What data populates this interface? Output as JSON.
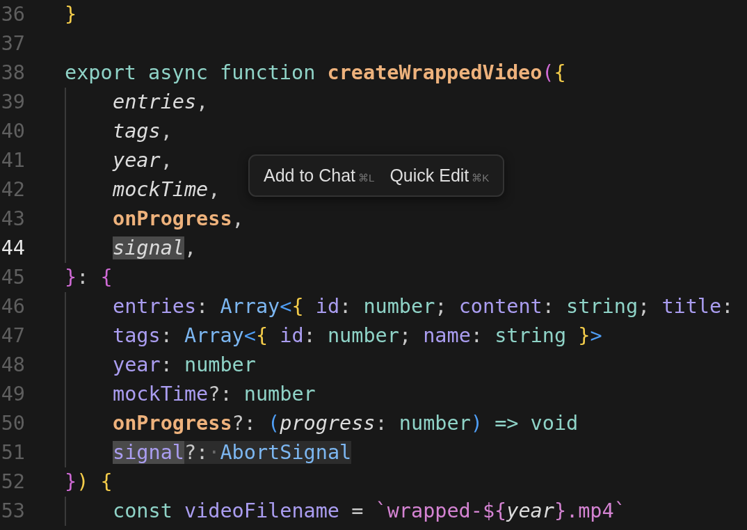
{
  "editor": {
    "lines": [
      {
        "number": "36",
        "active": false,
        "indented": false,
        "tokens": [
          {
            "kind": "brace-yellow",
            "text": "}"
          }
        ]
      },
      {
        "number": "37",
        "active": false,
        "indented": false
      },
      {
        "number": "38",
        "active": false,
        "indented": false,
        "tokens": [
          {
            "kind": "keyword",
            "text": "export async function "
          },
          {
            "kind": "func",
            "text": "createWrappedVideo"
          },
          {
            "kind": "brace-purple",
            "text": "("
          },
          {
            "kind": "brace-yellow",
            "text": "{"
          }
        ]
      },
      {
        "number": "39",
        "active": false,
        "indented": true,
        "tokens": [
          {
            "kind": "param",
            "text": "entries"
          },
          {
            "kind": "punct",
            "text": ","
          }
        ]
      },
      {
        "number": "40",
        "active": false,
        "indented": true,
        "tokens": [
          {
            "kind": "param",
            "text": "tags"
          },
          {
            "kind": "punct",
            "text": ","
          }
        ]
      },
      {
        "number": "41",
        "active": false,
        "indented": true,
        "tokens": [
          {
            "kind": "param",
            "text": "year"
          },
          {
            "kind": "punct",
            "text": ","
          }
        ]
      },
      {
        "number": "42",
        "active": false,
        "indented": true,
        "tokens": [
          {
            "kind": "param",
            "text": "mockTime"
          },
          {
            "kind": "punct",
            "text": ","
          }
        ]
      },
      {
        "number": "43",
        "active": false,
        "indented": true,
        "tokens": [
          {
            "kind": "param-bold",
            "text": "onProgress"
          },
          {
            "kind": "punct",
            "text": ","
          }
        ]
      },
      {
        "number": "44",
        "active": true,
        "indented": true,
        "tokens": [
          {
            "kind": "param",
            "text": "signal",
            "selected": true,
            "matched": false
          },
          {
            "kind": "punct",
            "text": ",",
            "selected": false,
            "matched": false
          }
        ]
      },
      {
        "number": "45",
        "active": false,
        "indented": false,
        "tokens": [
          {
            "kind": "brace-purple",
            "text": "}"
          },
          {
            "kind": "punct",
            "text": ": "
          },
          {
            "kind": "brace-purple",
            "text": "{"
          }
        ]
      },
      {
        "number": "46",
        "active": false,
        "indented": true,
        "tokens": [
          {
            "kind": "prop",
            "text": "entries"
          },
          {
            "kind": "punct",
            "text": ": "
          },
          {
            "kind": "class",
            "text": "Array"
          },
          {
            "kind": "brace-blue",
            "text": "<"
          },
          {
            "kind": "brace-yellow",
            "text": "{ "
          },
          {
            "kind": "prop",
            "text": "id"
          },
          {
            "kind": "punct",
            "text": ": "
          },
          {
            "kind": "type",
            "text": "number"
          },
          {
            "kind": "punct",
            "text": "; "
          },
          {
            "kind": "prop",
            "text": "content"
          },
          {
            "kind": "punct",
            "text": ": "
          },
          {
            "kind": "type",
            "text": "string"
          },
          {
            "kind": "punct",
            "text": "; "
          },
          {
            "kind": "prop",
            "text": "title"
          },
          {
            "kind": "punct",
            "text": ":"
          }
        ]
      },
      {
        "number": "47",
        "active": false,
        "indented": true,
        "tokens": [
          {
            "kind": "prop",
            "text": "tags"
          },
          {
            "kind": "punct",
            "text": ": "
          },
          {
            "kind": "class",
            "text": "Array"
          },
          {
            "kind": "brace-blue",
            "text": "<"
          },
          {
            "kind": "brace-yellow",
            "text": "{ "
          },
          {
            "kind": "prop",
            "text": "id"
          },
          {
            "kind": "punct",
            "text": ": "
          },
          {
            "kind": "type",
            "text": "number"
          },
          {
            "kind": "punct",
            "text": "; "
          },
          {
            "kind": "prop",
            "text": "name"
          },
          {
            "kind": "punct",
            "text": ": "
          },
          {
            "kind": "type",
            "text": "string "
          },
          {
            "kind": "brace-yellow",
            "text": "}"
          },
          {
            "kind": "brace-blue",
            "text": ">"
          }
        ]
      },
      {
        "number": "48",
        "active": false,
        "indented": true,
        "tokens": [
          {
            "kind": "prop",
            "text": "year"
          },
          {
            "kind": "punct",
            "text": ": "
          },
          {
            "kind": "type",
            "text": "number"
          }
        ]
      },
      {
        "number": "49",
        "active": false,
        "indented": true,
        "tokens": [
          {
            "kind": "prop",
            "text": "mockTime"
          },
          {
            "kind": "punct",
            "text": "?: "
          },
          {
            "kind": "type",
            "text": "number"
          }
        ]
      },
      {
        "number": "50",
        "active": false,
        "indented": true,
        "tokens": [
          {
            "kind": "param-bold",
            "text": "onProgress"
          },
          {
            "kind": "punct",
            "text": "?: "
          },
          {
            "kind": "brace-blue",
            "text": "("
          },
          {
            "kind": "param",
            "text": "progress"
          },
          {
            "kind": "punct",
            "text": ": "
          },
          {
            "kind": "type",
            "text": "number"
          },
          {
            "kind": "brace-blue",
            "text": ")"
          },
          {
            "kind": "type",
            "text": " => void"
          }
        ]
      },
      {
        "number": "51",
        "active": false,
        "indented": true,
        "tokens": [
          {
            "kind": "prop",
            "text": "signal",
            "selected": true,
            "matched": false
          },
          {
            "kind": "punct",
            "text": "?:",
            "selected": false,
            "matched": true
          },
          {
            "kind": "whitespace",
            "text": "·",
            "selected": false,
            "matched": true
          },
          {
            "kind": "class",
            "text": "AbortSignal",
            "selected": false,
            "matched": true
          }
        ]
      },
      {
        "number": "52",
        "active": false,
        "indented": false,
        "tokens": [
          {
            "kind": "brace-purple",
            "text": "}"
          },
          {
            "kind": "brace-yellow",
            "text": ") {"
          }
        ]
      },
      {
        "number": "53",
        "active": false,
        "indented": true,
        "tokens": [
          {
            "kind": "keyword",
            "text": "const "
          },
          {
            "kind": "prop",
            "text": "videoFilename"
          },
          {
            "kind": "punct",
            "text": " = "
          },
          {
            "kind": "string",
            "text": "`wrapped-${"
          },
          {
            "kind": "param",
            "text": "year"
          },
          {
            "kind": "string",
            "text": "}.mp4`"
          }
        ]
      }
    ]
  },
  "popup": {
    "actions": [
      {
        "label": "Add to Chat",
        "shortcut": "⌘L"
      },
      {
        "label": "Quick Edit",
        "shortcut": "⌘K"
      }
    ]
  }
}
